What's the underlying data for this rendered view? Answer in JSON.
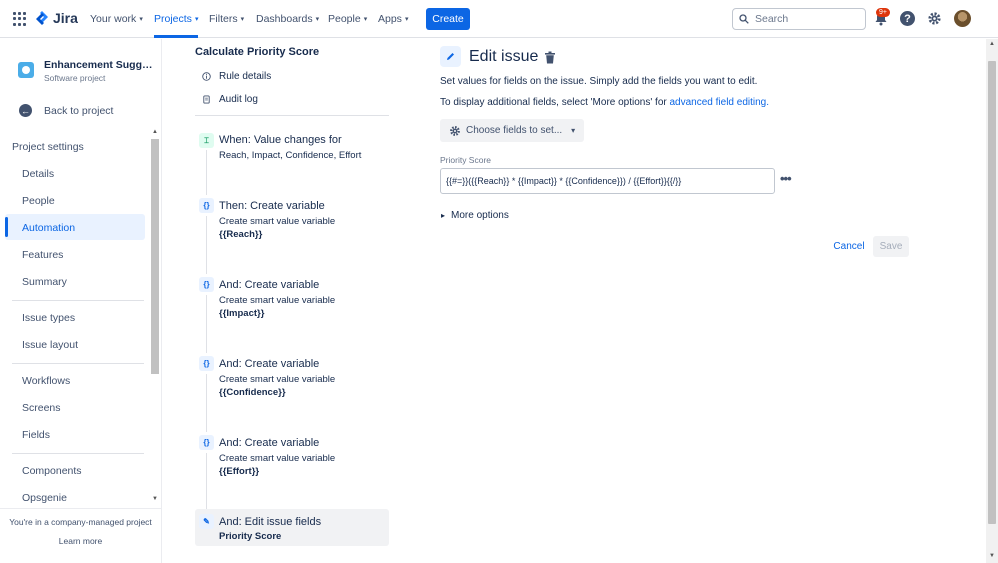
{
  "topnav": {
    "logo": "Jira",
    "items": [
      {
        "label": "Your work"
      },
      {
        "label": "Projects"
      },
      {
        "label": "Filters"
      },
      {
        "label": "Dashboards"
      },
      {
        "label": "People"
      },
      {
        "label": "Apps"
      }
    ],
    "active_item": "Projects",
    "create_label": "Create",
    "search_placeholder": "Search",
    "notification_badge": "9+"
  },
  "sidebar": {
    "project_name": "Enhancement Suggesti...",
    "project_type": "Software project",
    "back_label": "Back to project",
    "section_title": "Project settings",
    "items": [
      {
        "label": "Details"
      },
      {
        "label": "People"
      },
      {
        "label": "Automation"
      },
      {
        "label": "Features"
      },
      {
        "label": "Summary"
      },
      {
        "label": "Issue types"
      },
      {
        "label": "Issue layout"
      },
      {
        "label": "Workflows"
      },
      {
        "label": "Screens"
      },
      {
        "label": "Fields"
      },
      {
        "label": "Components"
      },
      {
        "label": "Opsgenie"
      }
    ],
    "active_item": "Automation",
    "footer_note": "You're in a company-managed project",
    "footer_link": "Learn more"
  },
  "rule": {
    "title": "Calculate Priority Score",
    "links": [
      {
        "label": "Rule details"
      },
      {
        "label": "Audit log"
      }
    ],
    "steps": [
      {
        "title": "When: Value changes for",
        "sub": "Reach, Impact, Confidence, Effort",
        "value": ""
      },
      {
        "title": "Then: Create variable",
        "sub": "Create smart value variable",
        "value": "{{Reach}}"
      },
      {
        "title": "And: Create variable",
        "sub": "Create smart value variable",
        "value": "{{Impact}}"
      },
      {
        "title": "And: Create variable",
        "sub": "Create smart value variable",
        "value": "{{Confidence}}"
      },
      {
        "title": "And: Create variable",
        "sub": "Create smart value variable",
        "value": "{{Effort}}"
      },
      {
        "title": "And: Edit issue fields",
        "sub": "",
        "value": "Priority Score"
      }
    ]
  },
  "editor": {
    "title": "Edit issue",
    "desc1": "Set values for fields on the issue. Simply add the fields you want to edit.",
    "desc2_prefix": "To display additional fields, select 'More options' for ",
    "desc2_link": "advanced field editing.",
    "choose_label": "Choose fields to set...",
    "field_label": "Priority Score",
    "field_value": "{{#=}}({{Reach}} * {{Impact}} * {{Confidence}}) / {{Effort}}{{/}}",
    "more_options": "More options",
    "cancel_label": "Cancel",
    "save_label": "Save"
  },
  "colors": {
    "accent": "#0c66e4",
    "badge": "#de350b",
    "trigger_icon": "#22a06b"
  }
}
